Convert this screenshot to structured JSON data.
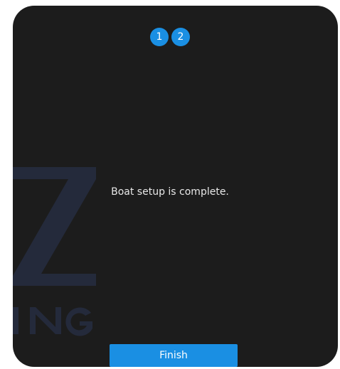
{
  "steps": [
    {
      "label": "1"
    },
    {
      "label": "2"
    }
  ],
  "message": "Boat setup is complete.",
  "finish_label": "Finish",
  "colors": {
    "panel": "#1c1c1c",
    "accent": "#1a8fe3",
    "text": "#e8e8e8",
    "watermark": "#2e3a5c"
  }
}
